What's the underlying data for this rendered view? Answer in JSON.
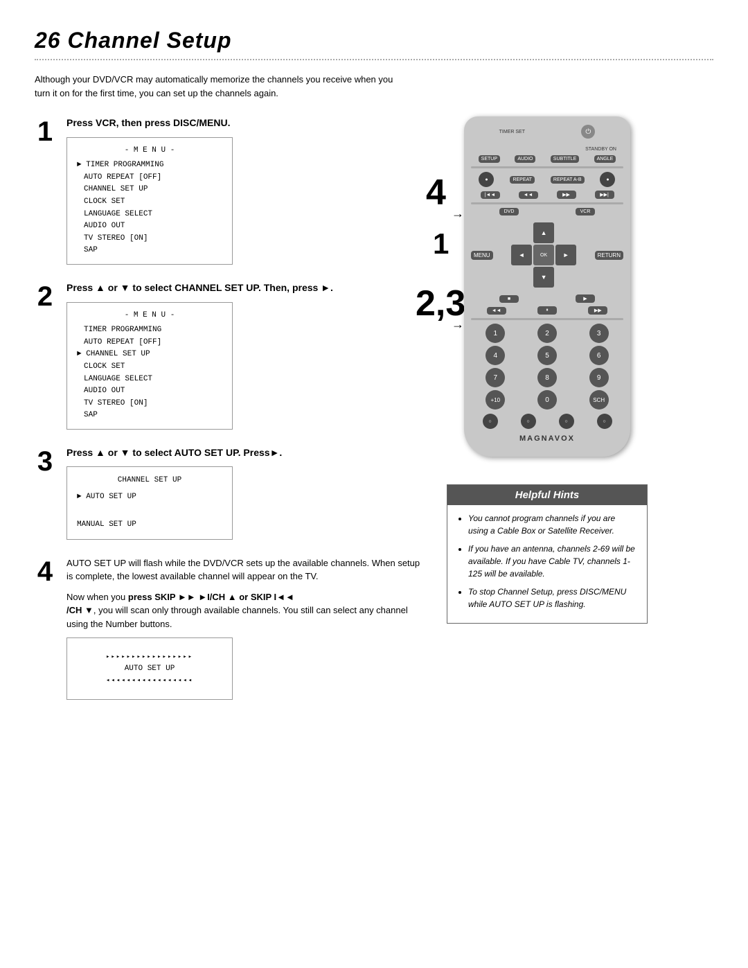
{
  "page": {
    "title": "26  Channel Setup",
    "intro": "Although your DVD/VCR may automatically memorize the channels you receive when you turn it on for the first time, you can set up the channels again."
  },
  "steps": [
    {
      "number": "1",
      "instruction": "Press VCR, then press DISC/MENU.",
      "menu": {
        "title": "- M E N U -",
        "items": [
          "► TIMER PROGRAMMING",
          "AUTO REPEAT   [OFF]",
          "CHANNEL SET UP",
          "CLOCK SET",
          "LANGUAGE SELECT",
          "AUDIO OUT",
          "TV STEREO      [ON]",
          "SAP"
        ]
      }
    },
    {
      "number": "2",
      "instruction_parts": [
        "Press ▲ or ▼ to select CHANNEL SET UP. Then, press ►."
      ],
      "menu": {
        "title": "- M E N U -",
        "items": [
          "TIMER PROGRAMMING",
          "AUTO REPEAT   [OFF]",
          "► CHANNEL SET UP",
          "CLOCK SET",
          "LANGUAGE SELECT",
          "AUDIO OUT",
          "TV STEREO      [ON]",
          "SAP"
        ]
      }
    },
    {
      "number": "3",
      "instruction": "Press ▲ or ▼ to select AUTO SET UP. Press►.",
      "submenu": {
        "title": "CHANNEL SET UP",
        "items": [
          "► AUTO SET UP",
          "",
          "MANUAL SET UP"
        ]
      }
    }
  ],
  "step4": {
    "number": "4",
    "text1": "AUTO SET UP will flash while the DVD/VCR sets up the available channels. When setup is complete, the lowest available channel will appear on the TV.",
    "text2": "Now when you press SKIP ►► ►I/CH ▲ or SKIP I◄◄ /CH ▼, you will scan only through available channels. You still can select any channel using the Number buttons.",
    "autosetup_label": "AUTO SET UP"
  },
  "hints": {
    "title": "Helpful Hints",
    "items": [
      "You cannot program channels if you are using a Cable Box or Satellite Receiver.",
      "If you have an antenna, channels 2-69 will be available. If you have Cable TV, channels 1-125 will be available.",
      "To stop Channel Setup, press DISC/MENU while AUTO SET UP is flashing."
    ]
  },
  "remote": {
    "brand": "MAGNAVOX",
    "step_labels": {
      "label4": "4",
      "label1": "1",
      "label23": "2,3"
    },
    "buttons": {
      "timer_set": "TIMER SET",
      "standby_on": "STANDBY ON",
      "setup": "SETUP",
      "audio": "AUDIO",
      "subtitle": "SUBTITLE",
      "angle": "ANGLE",
      "repeat": "REPEAT",
      "repeat_ab": "REPEAT A-B",
      "ok": "OK",
      "menu": "MENU",
      "return": "RETURN",
      "dvd": "DVD",
      "vcr": "VCR",
      "nums": [
        "1",
        "2",
        "3",
        "4",
        "5",
        "6",
        "7",
        "8",
        "9",
        "+10",
        "0",
        ""
      ]
    }
  }
}
